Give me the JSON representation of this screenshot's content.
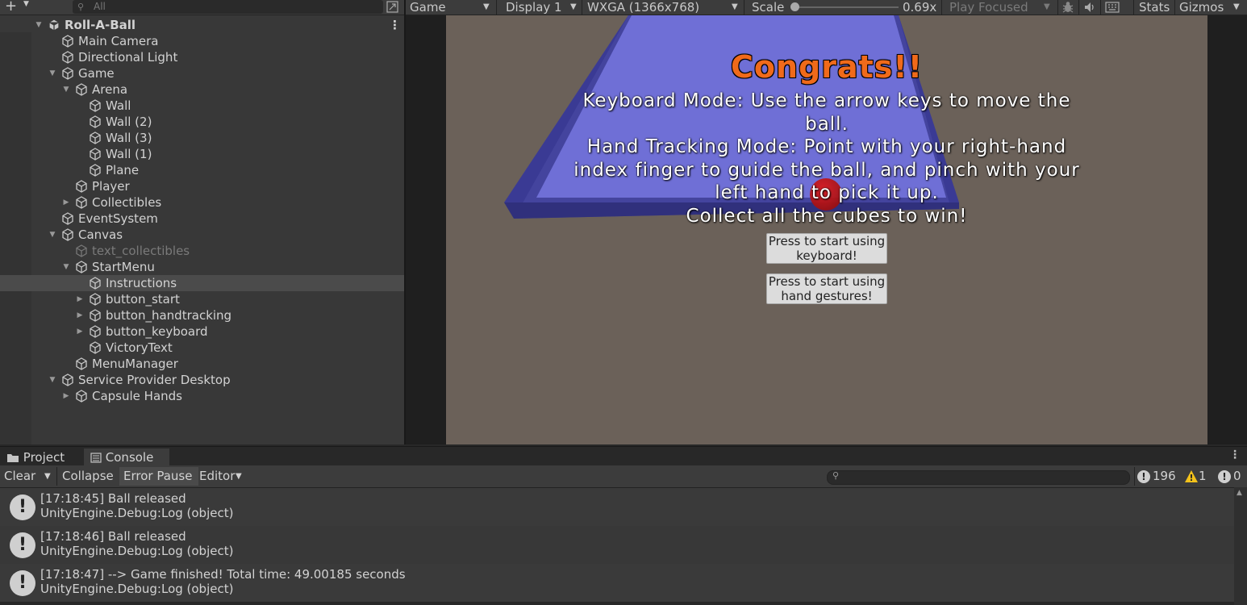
{
  "hierarchy": {
    "add_label": "+",
    "search_placeholder": "All",
    "rows": [
      {
        "label": "Roll-A-Ball",
        "fold": "open"
      },
      {
        "label": "Main Camera"
      },
      {
        "label": "Directional Light"
      },
      {
        "label": "Game",
        "fold": "open"
      },
      {
        "label": "Arena",
        "fold": "open"
      },
      {
        "label": "Wall"
      },
      {
        "label": "Wall (2)"
      },
      {
        "label": "Wall (3)"
      },
      {
        "label": "Wall (1)"
      },
      {
        "label": "Plane"
      },
      {
        "label": "Player"
      },
      {
        "label": "Collectibles",
        "fold": "closed"
      },
      {
        "label": "EventSystem"
      },
      {
        "label": "Canvas",
        "fold": "open"
      },
      {
        "label": "text_collectibles",
        "dim": true
      },
      {
        "label": "StartMenu",
        "fold": "open"
      },
      {
        "label": "Instructions",
        "selected": true
      },
      {
        "label": "button_start",
        "fold": "closed"
      },
      {
        "label": "button_handtracking",
        "fold": "closed"
      },
      {
        "label": "button_keyboard",
        "fold": "closed"
      },
      {
        "label": "VictoryText"
      },
      {
        "label": "MenuManager"
      },
      {
        "label": "Service Provider Desktop",
        "fold": "open"
      },
      {
        "label": "Capsule Hands",
        "fold": "closed"
      }
    ]
  },
  "game_toolbar": {
    "view": "Game",
    "display": "Display 1",
    "resolution": "WXGA (1366x768)",
    "scale_label": "Scale",
    "scale_value": "0.69x",
    "play_mode": "Play Focused",
    "stats": "Stats",
    "gizmos": "Gizmos"
  },
  "game": {
    "title": "Congrats!!",
    "instructions": [
      "Keyboard Mode: Use the arrow keys to move the",
      "ball.",
      "Hand Tracking Mode: Point with your right-hand",
      "index finger to guide the ball, and pinch with your",
      "left hand to pick it up.",
      "Collect all the cubes to win!"
    ],
    "button_keyboard": [
      "Press to start using",
      "keyboard!"
    ],
    "button_hand": [
      "Press to start using",
      "hand gestures!"
    ]
  },
  "bottom_tabs": {
    "project": "Project",
    "console": "Console"
  },
  "console_toolbar": {
    "clear": "Clear",
    "collapse": "Collapse",
    "error_pause": "Error Pause",
    "editor": "Editor",
    "log_count": "196",
    "warn_count": "1",
    "error_count": "0"
  },
  "logs": [
    {
      "line1": "[17:18:45] Ball released",
      "line2": "UnityEngine.Debug:Log (object)"
    },
    {
      "line1": "[17:18:46] Ball released",
      "line2": "UnityEngine.Debug:Log (object)"
    },
    {
      "line1": "[17:18:47] --> Game finished! Total time: 49.00185 seconds",
      "line2": "UnityEngine.Debug:Log (object)"
    }
  ],
  "colors": {
    "title_orange": "#f06a1a",
    "arena_blue": "#6f6fd6",
    "ball_red": "#e01818",
    "warn_yellow": "#f3c21b"
  }
}
